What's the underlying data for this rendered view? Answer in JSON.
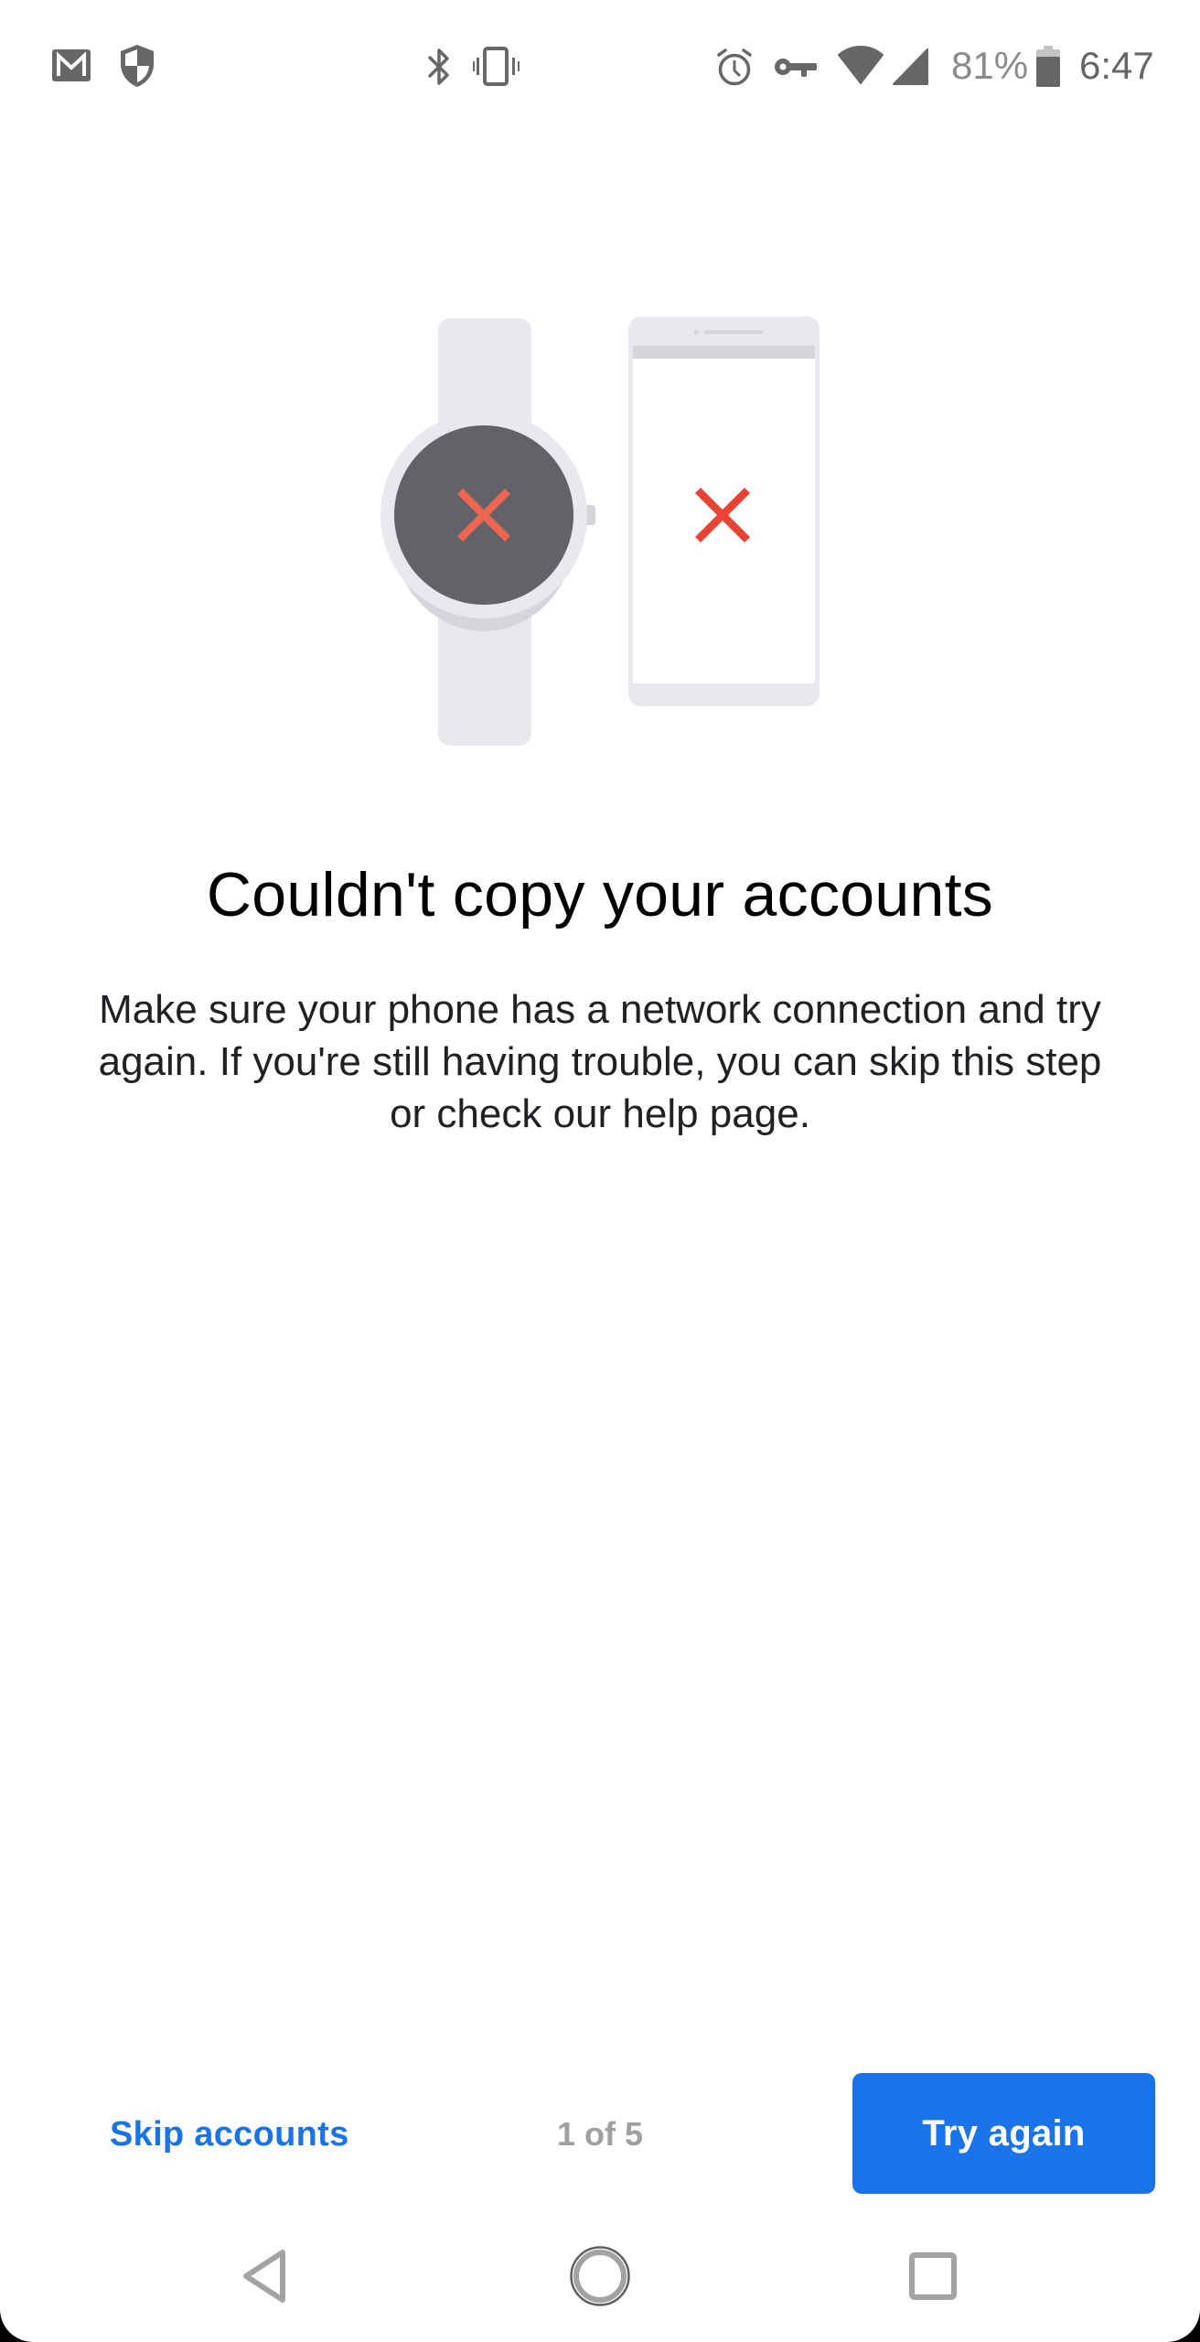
{
  "status_bar": {
    "left_icons": [
      "gmail-icon",
      "shield-icon"
    ],
    "center_icons": [
      "bluetooth-icon",
      "vibrate-icon"
    ],
    "right_icons": [
      "alarm-icon",
      "vpn-key-icon",
      "wifi-icon",
      "cell-signal-icon",
      "battery-icon"
    ],
    "battery_percent": "81%",
    "battery_level": 0.81,
    "time": "6:47"
  },
  "illustration": {
    "description": "Watch and phone both showing a red X",
    "watch_status_icon": "error-x-icon",
    "phone_status_icon": "error-x-icon",
    "colors": {
      "device_body": "#E8E9EC",
      "device_shadow": "#D4D6DC",
      "watch_face": "#616368",
      "watch_x": "#EC6650",
      "phone_x": "#EA4335"
    }
  },
  "content": {
    "title": "Couldn't copy your accounts",
    "body_lines": [
      "Make sure your phone has a network connection and try",
      "again. If you're still having trouble, you can skip this step",
      "or check our help page."
    ]
  },
  "footer": {
    "skip_label": "Skip accounts",
    "step_indicator": "1 of 5",
    "primary_label": "Try again",
    "accent_color": "#1A73E8"
  },
  "nav_bar": {
    "back": "back-icon",
    "home": "home-icon",
    "recents": "recents-icon"
  }
}
